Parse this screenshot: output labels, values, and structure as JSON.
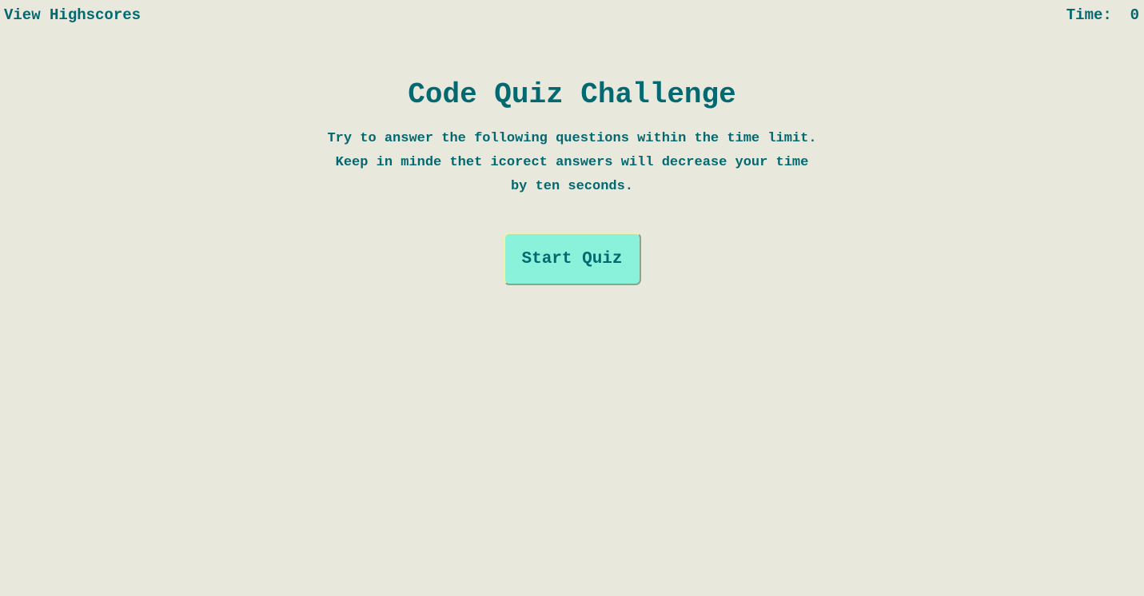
{
  "header": {
    "highscores_link": "View Highscores",
    "timer_label": "Time:",
    "timer_value": "0"
  },
  "intro": {
    "title": "Code Quiz Challenge",
    "description_lines": [
      "Try to answer the following questions within the time limit.",
      "Keep in minde thet icorect answers will decrease your time",
      "by ten seconds."
    ],
    "start_button_label": "Start Quiz"
  },
  "colors": {
    "background": "#e9e8dc",
    "text": "#036870",
    "button_fill": "#8af2da"
  }
}
